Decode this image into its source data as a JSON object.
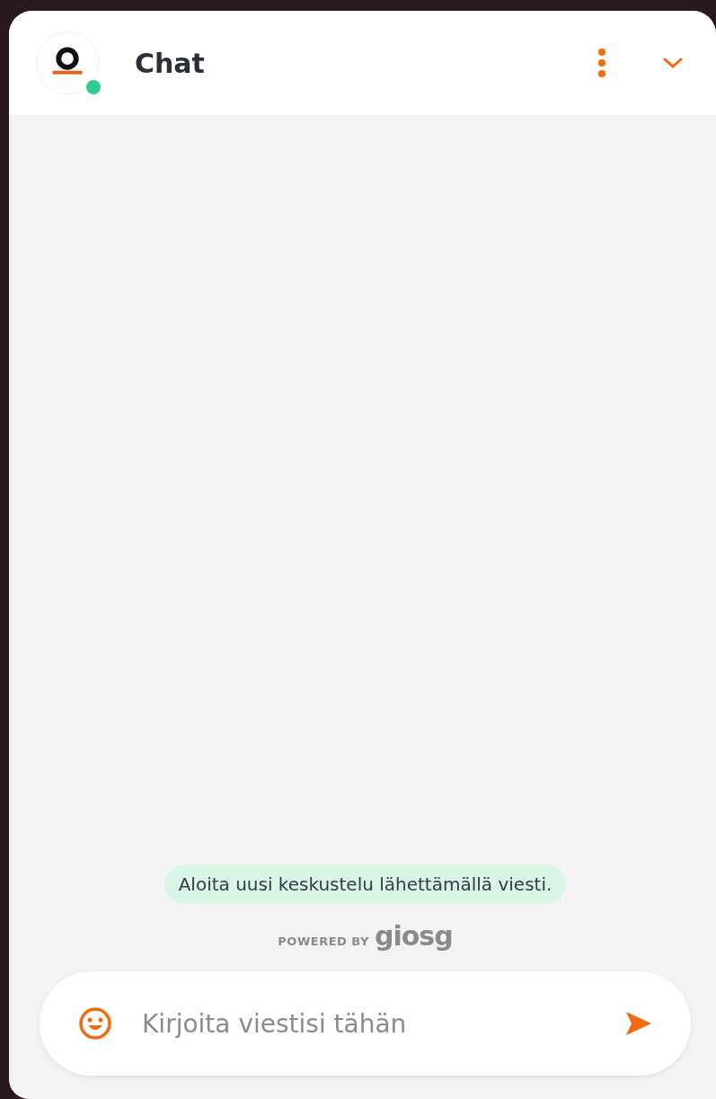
{
  "header": {
    "title": "Chat",
    "online": true
  },
  "notice": "Aloita uusi keskustelu lähettämällä viesti.",
  "branding": {
    "prefix": "POWERED BY",
    "name": "giosg"
  },
  "composer": {
    "placeholder": "Kirjoita viestisi tähän"
  }
}
